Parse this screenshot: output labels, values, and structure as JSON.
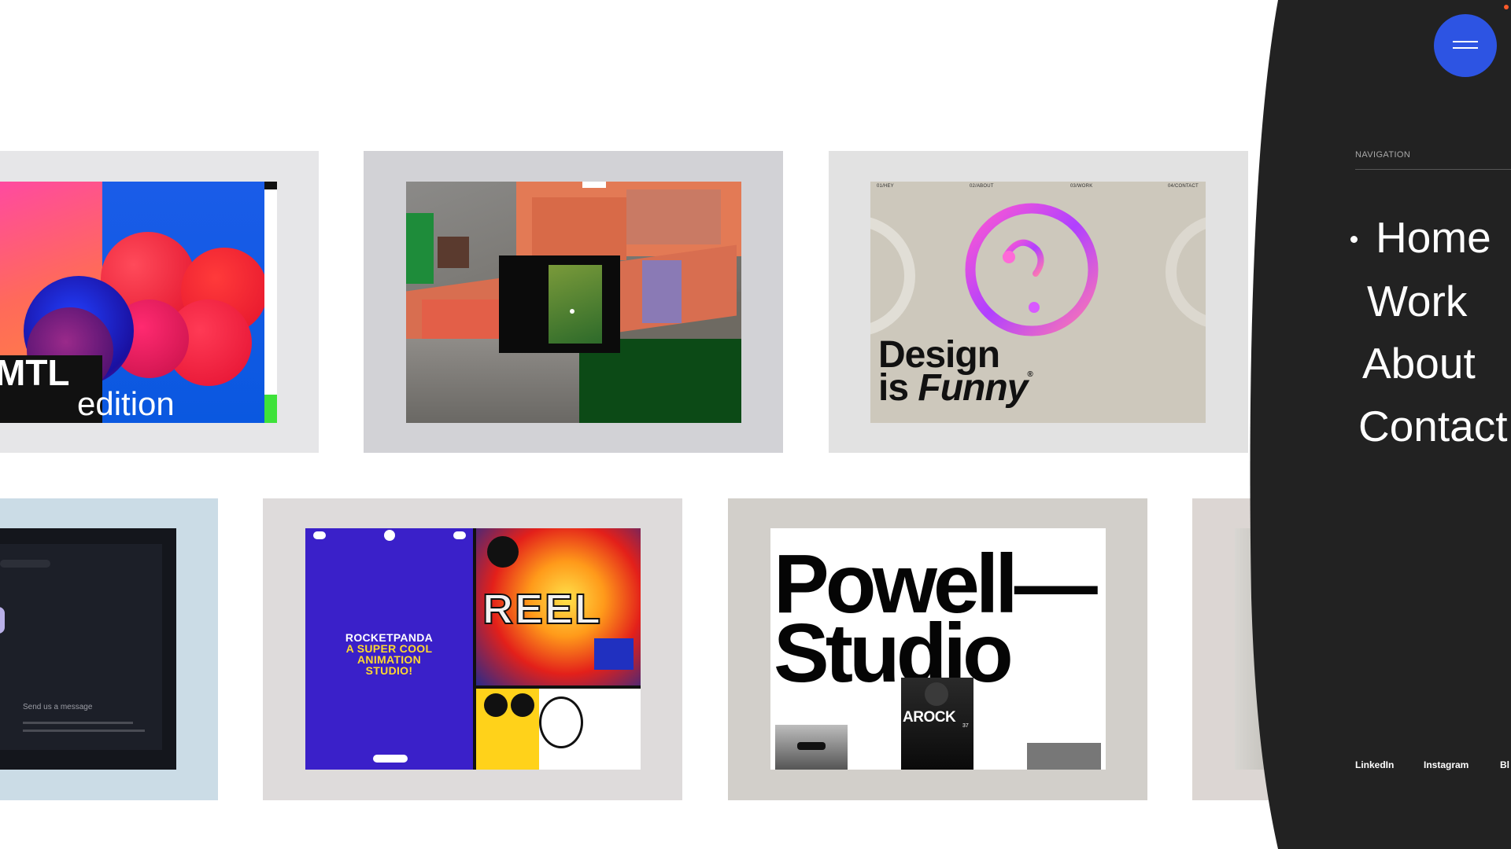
{
  "colors": {
    "sidebar_bg": "#222222",
    "menu_button": "#2d54e3",
    "accent_green": "#3ee23a",
    "rocketpanda_blue": "#3a20c9",
    "rocketpanda_yellow": "#ffd92e"
  },
  "header": {
    "menu_button_icon": "hamburger-icon",
    "notification_icon": "dot-icon"
  },
  "projects": [
    {
      "name": "mtl-edition",
      "text_line1": "MTL",
      "text_line2": "edition"
    },
    {
      "name": "aerial-map"
    },
    {
      "name": "design-is-funny",
      "nav": [
        "01/HEY",
        "02/ABOUT",
        "03/WORK",
        "04/CONTACT"
      ],
      "title_line1": "Design",
      "title_is": "is",
      "title_funny": "Funny",
      "registered": "®"
    },
    {
      "name": "send-message",
      "heading": "Send us a message"
    },
    {
      "name": "rocketpanda",
      "line1": "ROCKETPANDA",
      "line2": "A SUPER COOL",
      "line3": "ANIMATION",
      "line4": "STUDIO!",
      "reel_text": "REEL"
    },
    {
      "name": "powell-studio",
      "title_line1": "Powell—",
      "title_line2": "Studio",
      "badge": "AROCK",
      "badge_number": "37"
    },
    {
      "name": "partial-card"
    }
  ],
  "navigation": {
    "title": "NAVIGATION",
    "items": [
      {
        "label": "Home",
        "active": true
      },
      {
        "label": "Work",
        "active": false
      },
      {
        "label": "About",
        "active": false
      },
      {
        "label": "Contact",
        "active": false
      }
    ]
  },
  "social": [
    {
      "label": "LinkedIn"
    },
    {
      "label": "Instagram"
    },
    {
      "label": "Bl"
    }
  ]
}
